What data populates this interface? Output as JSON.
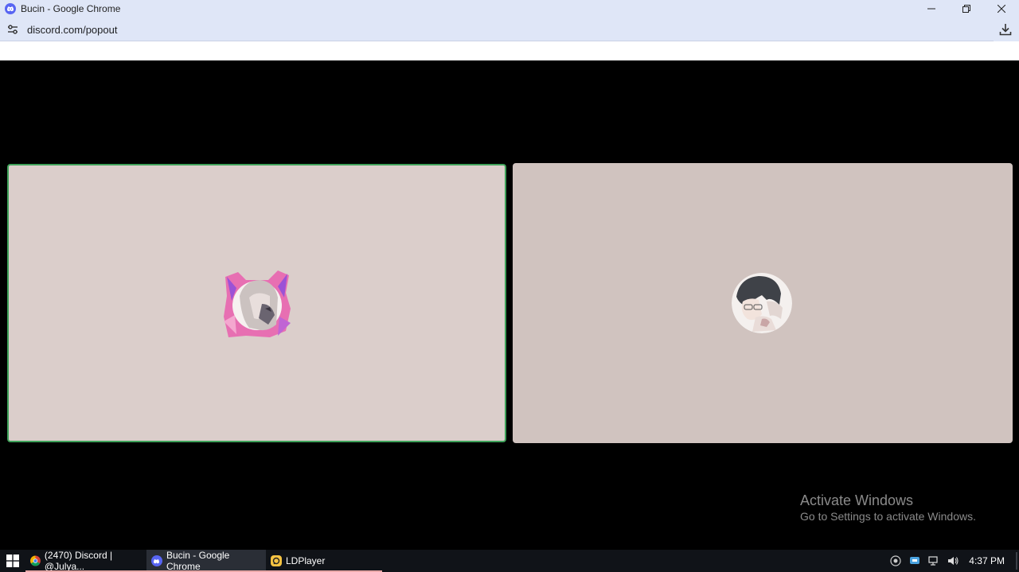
{
  "window": {
    "title": "Bucin - Google Chrome",
    "controls": {
      "minimize": "—",
      "restore": "❐",
      "close": "✕"
    }
  },
  "address": {
    "url": "discord.com/popout"
  },
  "call": {
    "speaking_color": "#3fa25a",
    "participants": [
      {
        "avatar": "anime-girl-avatar",
        "speaking": true
      },
      {
        "avatar": "anime-boy-avatar",
        "speaking": false
      }
    ]
  },
  "watermark": {
    "title": "Activate Windows",
    "subtitle": "Go to Settings to activate Windows."
  },
  "taskbar": {
    "items": [
      {
        "label": "(2470) Discord | @Julya...",
        "icon": "chrome-icon"
      },
      {
        "label": "Bucin - Google Chrome",
        "icon": "discord-icon",
        "active": true
      },
      {
        "label": "LDPlayer",
        "icon": "ldplayer-icon"
      }
    ],
    "clock": "4:37 PM"
  }
}
